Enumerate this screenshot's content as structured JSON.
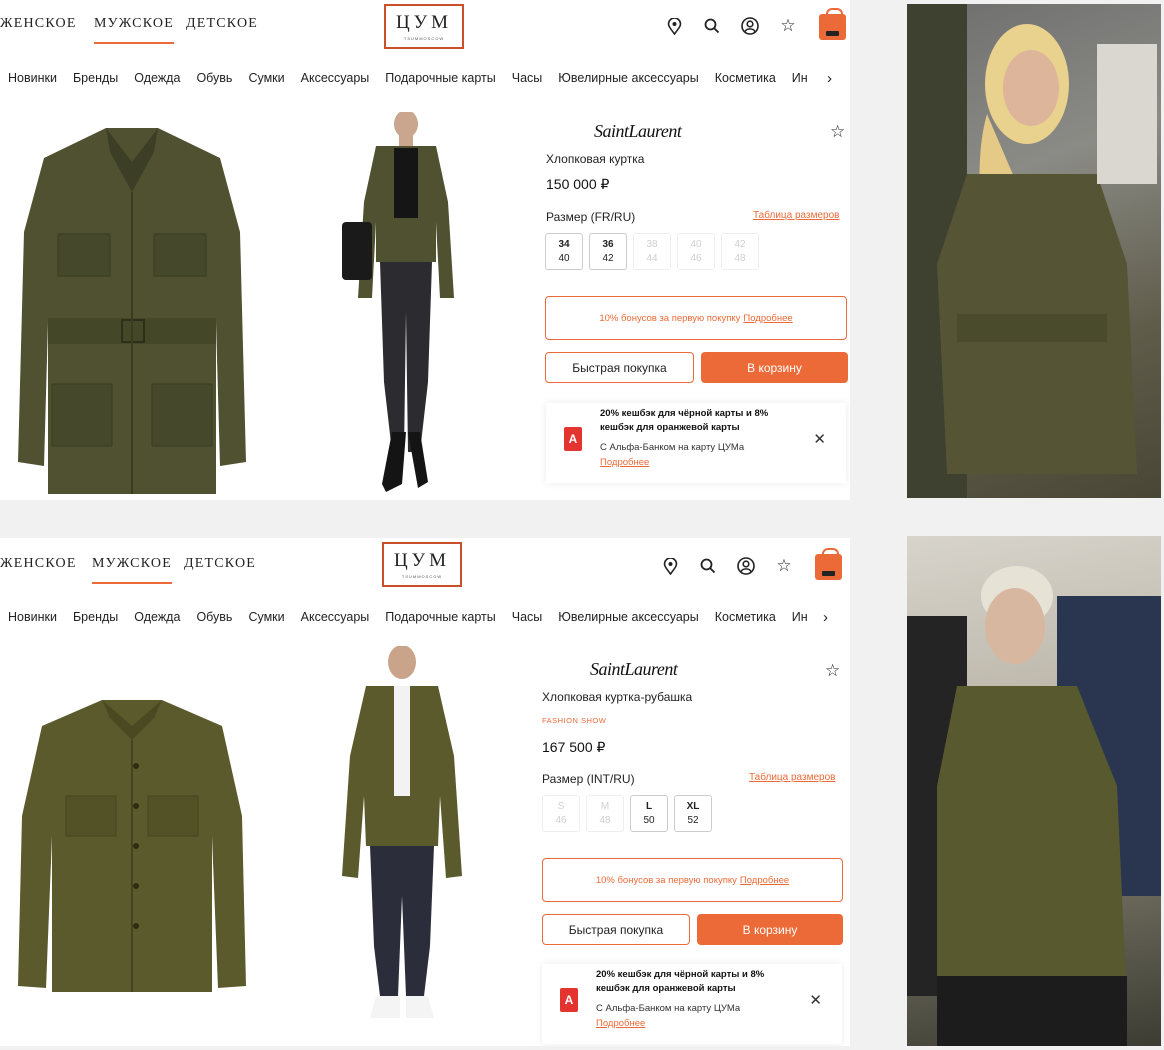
{
  "nav": {
    "women": "ЖЕНСКОЕ",
    "men": "МУЖСКОЕ",
    "kids": "ДЕТСКОЕ",
    "logo_letters": "ЦУМ",
    "logo_sub": "TSUMMOSCOW",
    "categories": [
      "Новинки",
      "Бренды",
      "Одежда",
      "Обувь",
      "Сумки",
      "Аксессуары",
      "Подарочные карты",
      "Часы",
      "Ювелирные аксессуары",
      "Косметика",
      "Ин"
    ],
    "icons": [
      "location-pin-icon",
      "search-icon",
      "user-icon",
      "star-icon",
      "shopping-bag-icon"
    ]
  },
  "products": [
    {
      "brand": "SaintLaurent",
      "name": "Хлопковая куртка",
      "tag": "",
      "price": "150 000 ₽",
      "size_label": "Размер (FR/RU)",
      "size_table": "Таблица размеров",
      "sizes": [
        {
          "top": "34",
          "bottom": "40",
          "available": true
        },
        {
          "top": "36",
          "bottom": "42",
          "available": true
        },
        {
          "top": "38",
          "bottom": "44",
          "available": false
        },
        {
          "top": "40",
          "bottom": "46",
          "available": false
        },
        {
          "top": "42",
          "bottom": "48",
          "available": false
        }
      ],
      "bonus_text": "10% бонусов за первую покупку",
      "bonus_link": "Подробнее",
      "quick_buy": "Быстрая покупка",
      "add_to_cart": "В корзину",
      "promo_title": "20% кешбэк для чёрной карты и 8% кешбэк для оранжевой карты",
      "promo_sub": "С Альфа-Банком на карту ЦУМа",
      "promo_link": "Подробнее",
      "bank_letter": "А",
      "close": "✕",
      "colors": {
        "accent": "#ec6a37",
        "jacket": "#4f5131"
      }
    },
    {
      "brand": "SaintLaurent",
      "name": "Хлопковая куртка-рубашка",
      "tag": "FASHION SHOW",
      "price": "167 500 ₽",
      "size_label": "Размер (INT/RU)",
      "size_table": "Таблица размеров",
      "sizes": [
        {
          "top": "S",
          "bottom": "46",
          "available": false
        },
        {
          "top": "M",
          "bottom": "48",
          "available": false
        },
        {
          "top": "L",
          "bottom": "50",
          "available": true
        },
        {
          "top": "XL",
          "bottom": "52",
          "available": true
        }
      ],
      "bonus_text": "10% бонусов за первую покупку",
      "bonus_link": "Подробнее",
      "quick_buy": "Быстрая покупка",
      "add_to_cart": "В корзину",
      "promo_title": "20% кешбэк для чёрной карты и 8% кешбэк для оранжевой карты",
      "promo_sub": "С Альфа-Банком на карту ЦУМа",
      "promo_link": "Подробнее",
      "bank_letter": "А",
      "close": "✕",
      "colors": {
        "accent": "#ec6a37",
        "jacket": "#5b5a2c"
      }
    }
  ]
}
